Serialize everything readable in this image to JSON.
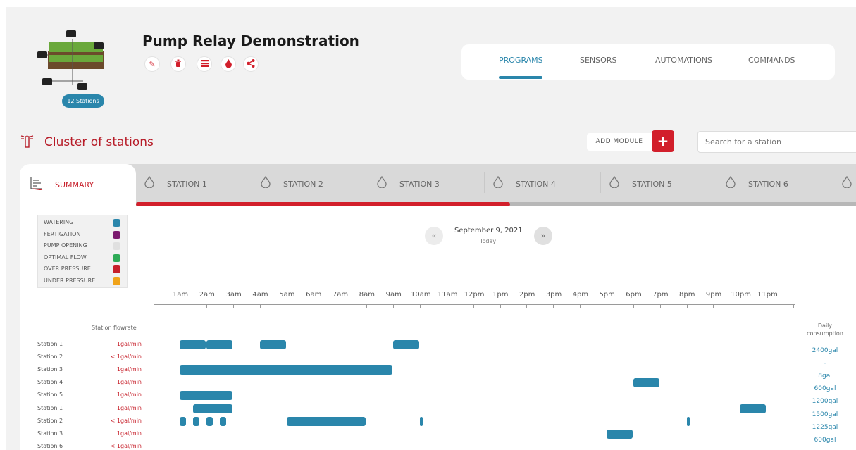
{
  "header": {
    "title": "Pump Relay Demonstration",
    "stations_badge": "12 Stations",
    "actions": [
      {
        "name": "edit-icon",
        "glyph": "✎"
      },
      {
        "name": "trash-icon",
        "glyph": "🗑"
      },
      {
        "name": "list-icon",
        "glyph": "☰"
      },
      {
        "name": "drop-icon",
        "glyph": "💧"
      },
      {
        "name": "share-icon",
        "glyph": "⋖"
      }
    ]
  },
  "nav": {
    "tabs": [
      {
        "label": "PROGRAMS",
        "active": true
      },
      {
        "label": "SENSORS",
        "active": false
      },
      {
        "label": "AUTOMATIONS",
        "active": false
      },
      {
        "label": "COMMANDS",
        "active": false
      }
    ]
  },
  "cluster": {
    "title": "Cluster of stations",
    "add_module_label": "ADD MODULE",
    "add_button_glyph": "+",
    "search_placeholder": "Search for a station"
  },
  "station_tabs": {
    "summary_label": "SUMMARY",
    "tabs": [
      "STATION 1",
      "STATION 2",
      "STATION 3",
      "STATION 4",
      "STATION 5",
      "STATION 6"
    ],
    "progress_fraction": 0.52
  },
  "legend": [
    {
      "label": "WATERING",
      "color": "#2a86ab"
    },
    {
      "label": "FERTIGATION",
      "color": "#7a1a6e"
    },
    {
      "label": "PUMP OPENING",
      "color": "#e0e0e0"
    },
    {
      "label": "OPTIMAL FLOW",
      "color": "#2eab57"
    },
    {
      "label": "OVER PRESSURE.",
      "color": "#c7202b"
    },
    {
      "label": "UNDER PRESSURE",
      "color": "#f0a31a"
    }
  ],
  "date": {
    "prev_glyph": "«",
    "next_glyph": "»",
    "label": "September 9, 2021",
    "sub": "Today"
  },
  "timeline": {
    "hours": [
      "1am",
      "2am",
      "3am",
      "4am",
      "5am",
      "6am",
      "7am",
      "8am",
      "9am",
      "10am",
      "11am",
      "12pm",
      "1pm",
      "2pm",
      "3pm",
      "4pm",
      "5pm",
      "6pm",
      "7pm",
      "8pm",
      "9pm",
      "10pm",
      "11pm"
    ],
    "flowrate_header": "Station flowrate",
    "consumption_header_1": "Daily",
    "consumption_header_2": "consumption",
    "rows": [
      {
        "name": "Station 1",
        "flow": "1gal/min",
        "consumption": "2400gal",
        "bars": [
          [
            1.0,
            2.0
          ],
          [
            2.0,
            3.0
          ],
          [
            4.0,
            5.0
          ],
          [
            9.0,
            10.0
          ]
        ]
      },
      {
        "name": "Station 2",
        "flow": "< 1gal/min",
        "consumption": "-",
        "bars": []
      },
      {
        "name": "Station 3",
        "flow": "1gal/min",
        "consumption": "8gal",
        "bars": [
          [
            1.0,
            9.0
          ]
        ]
      },
      {
        "name": "Station 4",
        "flow": "1gal/min",
        "consumption": "600gal",
        "bars": [
          [
            18.0,
            19.0
          ]
        ]
      },
      {
        "name": "Station 5",
        "flow": "1gal/min",
        "consumption": "1200gal",
        "bars": [
          [
            1.0,
            3.0
          ]
        ]
      },
      {
        "name": "Station 1",
        "flow": "1gal/min",
        "consumption": "1500gal",
        "bars": [
          [
            1.5,
            3.0
          ],
          [
            22.0,
            23.0
          ]
        ]
      },
      {
        "name": "Station 2",
        "flow": "< 1gal/min",
        "consumption": "1225gal",
        "bars": [
          [
            1.0,
            1.25
          ],
          [
            1.5,
            1.75
          ],
          [
            2.0,
            2.25
          ],
          [
            2.5,
            2.75
          ],
          [
            5.0,
            8.0
          ],
          [
            10.0,
            10.1
          ],
          [
            20.0,
            20.15
          ]
        ]
      },
      {
        "name": "Station 3",
        "flow": "1gal/min",
        "consumption": "600gal",
        "bars": [
          [
            17.0,
            18.0
          ]
        ]
      },
      {
        "name": "Station 6",
        "flow": "< 1gal/min",
        "consumption": "",
        "bars": []
      }
    ]
  }
}
